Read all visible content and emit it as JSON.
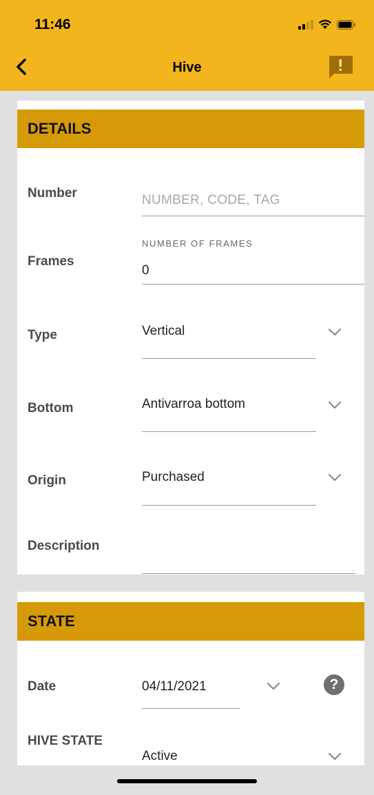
{
  "status_bar": {
    "time": "11:46"
  },
  "navbar": {
    "title": "Hive"
  },
  "details": {
    "header": "DETAILS",
    "number": {
      "label": "Number",
      "placeholder": "NUMBER, CODE, TAG"
    },
    "frames": {
      "label": "Frames",
      "caption": "NUMBER OF FRAMES",
      "value": "0"
    },
    "type": {
      "label": "Type",
      "value": "Vertical"
    },
    "bottom": {
      "label": "Bottom",
      "value": "Antivarroa bottom"
    },
    "origin": {
      "label": "Origin",
      "value": "Purchased"
    },
    "description": {
      "label": "Description",
      "value": ""
    }
  },
  "state": {
    "header": "STATE",
    "date": {
      "label": "Date",
      "value": "04/11/2021",
      "help": "?"
    },
    "hive_state": {
      "label": "HIVE STATE",
      "value": "Active"
    }
  },
  "colors": {
    "accent": "#f2b51d",
    "section_header": "#d69a08"
  },
  "icons": [
    "back-chevron-icon",
    "report-icon",
    "chevron-down-icon",
    "help-icon"
  ]
}
